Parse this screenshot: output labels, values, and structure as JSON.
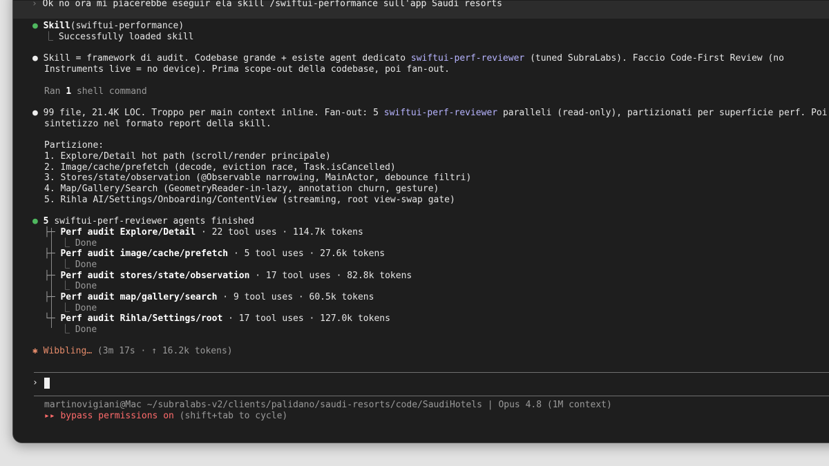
{
  "user_message": {
    "chevron": "›",
    "text": "Ok no ora mi piacerebbe eseguir ela skill /swiftui-performance sull'app Saudi resorts"
  },
  "skill_call": {
    "bullet": "●",
    "name": "Skill",
    "args": "(swiftui-performance)",
    "result_prefix": "⎿",
    "result": "Successfully loaded skill"
  },
  "message_1": {
    "bullet": "●",
    "part1": "Skill = framework di audit. Codebase grande + esiste agent dedicato ",
    "agent": "swiftui-perf-reviewer",
    "part2": " (tuned SubraLabs). Faccio Code-First Review (no",
    "line2": "Instruments live = no device). Prima scope-out della codebase, poi fan-out."
  },
  "shell_summary": {
    "ran": "Ran ",
    "count": "1",
    "rest": " shell command"
  },
  "message_2": {
    "bullet": "●",
    "part1": "99 file, 21.4K LOC. Troppo per main context inline. Fan-out: 5 ",
    "agent": "swiftui-perf-reviewer",
    "part2": " paralleli (read-only), partizionati per superficie perf. Poi",
    "line2": "sintetizzo nel formato report della skill.",
    "partition_title": "Partizione:",
    "partitions": [
      "1. Explore/Detail hot path (scroll/render principale)",
      "2. Image/cache/prefetch (decode, eviction race, Task.isCancelled)",
      "3. Stores/state/observation (@Observable narrowing, MainActor, debounce filtri)",
      "4. Map/Gallery/Search (GeometryReader-in-lazy, annotation churn, gesture)",
      "5. Rihla AI/Settings/Onboarding/ContentView (streaming, root view-swap gate)"
    ]
  },
  "agents_block": {
    "bullet": "●",
    "count": "5",
    "agent": "swiftui-perf-reviewer",
    "suffix": " agents finished",
    "branch_mid": "├─",
    "branch_end": "└─",
    "done_prefix": "⎿",
    "done_label": "Done",
    "items": [
      {
        "title": "Perf audit Explore/Detail",
        "stats": " · 22 tool uses · 114.7k tokens"
      },
      {
        "title": "Perf audit image/cache/prefetch",
        "stats": " · 5 tool uses · 27.6k tokens"
      },
      {
        "title": "Perf audit stores/state/observation",
        "stats": " · 17 tool uses · 82.8k tokens"
      },
      {
        "title": "Perf audit map/gallery/search",
        "stats": " · 9 tool uses · 60.5k tokens"
      },
      {
        "title": "Perf audit Rihla/Settings/root",
        "stats": " · 17 tool uses · 127.0k tokens"
      }
    ]
  },
  "status": {
    "spinner": "✱",
    "label": "Wibbling…",
    "details": " (3m 17s · ↑ 16.2k tokens)"
  },
  "input": {
    "chevron": "›",
    "value": ""
  },
  "footer": {
    "path": "martinovigiani@Mac ~/subralabs-v2/clients/palidano/saudi-resorts/code/SaudiHotels | Opus 4.8 (1M context)",
    "arrows": "▸▸",
    "mode": "bypass permissions on",
    "hint": " (shift+tab to cycle)"
  },
  "colors": {
    "background": "#1e1e1e",
    "user_row": "#2c2c2c",
    "success_bullet": "#4fb85f",
    "agent_link": "#b7b4ff",
    "status_orange": "#e58b6a",
    "bypass_red": "#ff6b6b"
  }
}
